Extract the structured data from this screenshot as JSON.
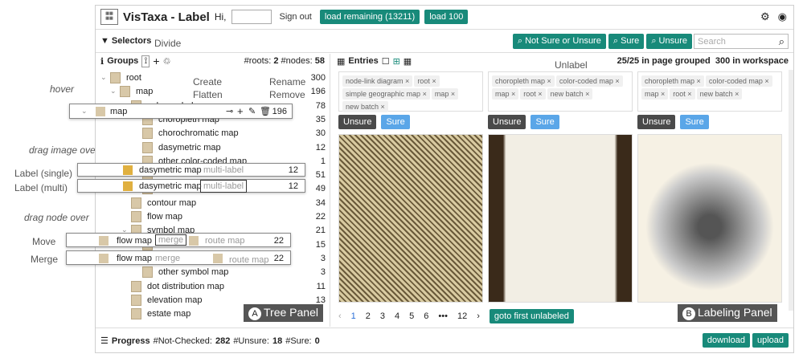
{
  "topbar": {
    "app_title": "VisTaxa - Label",
    "hi": "Hi,",
    "sign_out": "Sign out",
    "load_remaining": "load remaining (13211)",
    "load_100": "load 100"
  },
  "selectors": {
    "title": "Selectors",
    "not_sure": "Not Sure or Unsure",
    "sure": "Sure",
    "unsure": "Unsure",
    "search_placeholder": "Search"
  },
  "groups": {
    "title": "Groups",
    "roots_label": "#roots:",
    "roots": "2",
    "nodes_label": "#nodes:",
    "nodes": "58",
    "rows": [
      {
        "label": "root",
        "count": "300"
      },
      {
        "label": "map",
        "count": "196"
      },
      {
        "label": "color-coded map",
        "count": "78"
      },
      {
        "label": "choropleth map",
        "count": "35"
      },
      {
        "label": "chorochromatic map",
        "count": "30"
      },
      {
        "label": "dasymetric map",
        "count": "12"
      },
      {
        "label": "other color-coded map",
        "count": "1"
      },
      {
        "label": "",
        "count": "51"
      },
      {
        "label": "",
        "count": "49"
      },
      {
        "label": "contour map",
        "count": "34"
      },
      {
        "label": "flow map",
        "count": "22"
      },
      {
        "label": "symbol map",
        "count": "21"
      },
      {
        "label": "",
        "count": "15"
      },
      {
        "label": "",
        "count": "3"
      },
      {
        "label": "other symbol map",
        "count": "3"
      },
      {
        "label": "dot distribution map",
        "count": "11"
      },
      {
        "label": "elevation map",
        "count": "13"
      },
      {
        "label": "estate map",
        "count": ""
      }
    ]
  },
  "entries": {
    "title": "Entries",
    "page_grouped": "25/25 in page grouped",
    "workspace": "300 in workspace",
    "cards": [
      {
        "tags": [
          "node-link diagram",
          "root",
          "simple geographic map",
          "map",
          "new batch"
        ]
      },
      {
        "tags": [
          "choropleth map",
          "color-coded map",
          "map",
          "root",
          "new batch"
        ]
      },
      {
        "tags": [
          "choropleth map",
          "color-coded map",
          "map",
          "root",
          "new batch"
        ]
      }
    ],
    "unsure": "Unsure",
    "sure": "Sure",
    "pages": [
      "1",
      "2",
      "3",
      "4",
      "5",
      "6",
      "•••",
      "12"
    ],
    "goto": "goto first unlabeled"
  },
  "progress": {
    "title": "Progress",
    "not_checked_label": "#Not-Checked:",
    "not_checked": "282",
    "unsure_label": "#Unsure:",
    "unsure": "18",
    "sure_label": "#Sure:",
    "sure": "0",
    "download": "download",
    "upload": "upload"
  },
  "annotations": {
    "hover": "hover",
    "drag_image_over": "drag image over",
    "label_single": "Label (single)",
    "label_multi": "Label (multi)",
    "drag_node_over": "drag node over",
    "move": "Move",
    "merge": "Merge",
    "divide": "Divide",
    "create": "Create",
    "flatten": "Flatten",
    "rename": "Rename",
    "remove": "Remove",
    "unlabel": "Unlabel",
    "tree_panel": "Tree Panel",
    "labeling_panel": "Labeling Panel",
    "a": "A",
    "b": "B",
    "multi_label": "multi-label",
    "merge_word": "merge",
    "route_map": "route map",
    "hover_map": "map",
    "hover_count": "196",
    "ov_dasy": "dasymetric map",
    "ov_dasy_count_1": "12",
    "ov_dasy_count_2": "12",
    "ov_flow": "flow map",
    "ov_flow_count_1": "22",
    "ov_flow_count_2": "22"
  },
  "colors": {
    "teal": "#188a7a",
    "blue": "#5aa6e8",
    "dark": "#4a4a4a"
  }
}
